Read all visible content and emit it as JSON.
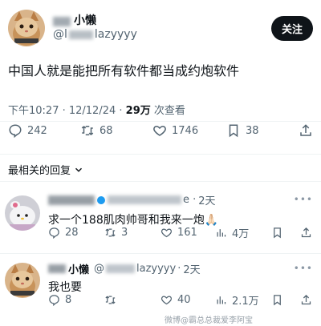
{
  "tweet": {
    "display_name": "小懒",
    "handle_suffix": "lazyyyy",
    "follow_label": "关注",
    "text": "中国人就是能把所有软件都当成约炮软件",
    "time": "下午10:27 · 12/12/24 · ",
    "views_count": "29万",
    "views_label": " 次查看",
    "stats": {
      "replies": "242",
      "retweets": "68",
      "likes": "1746",
      "bookmarks": "38"
    }
  },
  "sort_label": "最相关的回复",
  "replies": [
    {
      "time": "2天",
      "text": "求一个188肌肉帅哥和我来一炮🙏🏻",
      "stats": {
        "replies": "28",
        "retweets": "3",
        "likes": "161",
        "views": "4万"
      }
    },
    {
      "display_name": "小懒",
      "handle_suffix": "lazyyyy",
      "time": "2天",
      "text": "我也要",
      "stats": {
        "replies": "8",
        "retweets": "",
        "likes": "40",
        "views": "2.1万"
      }
    }
  ],
  "watermark": "微博@霸总总裁爱李阿宝",
  "colors": {
    "text": "#0f1419",
    "secondary": "#536471",
    "divider": "#eff3f4",
    "button": "#0f1419"
  }
}
